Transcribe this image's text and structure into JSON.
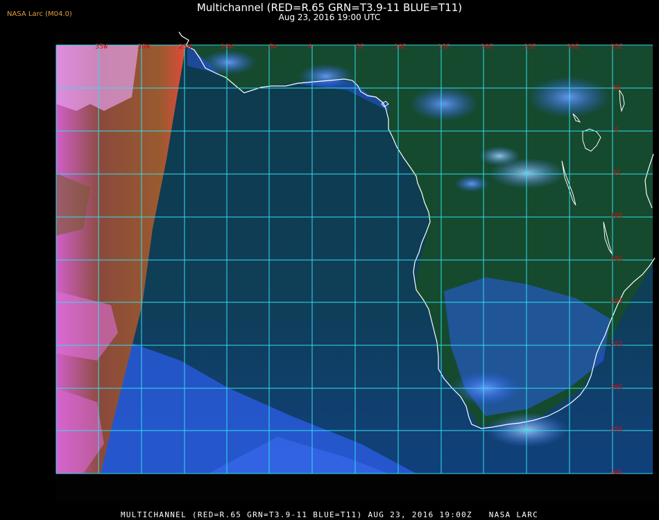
{
  "badge": "NASA Larc (M04.0)",
  "title": "Multichannel (RED=R.65 GRN=T3.9-11 BLUE=T11)",
  "subtitle": "Aug 23, 2016 19:00 UTC",
  "footer": "MULTICHANNEL (RED=R.65 GRN=T3.9-11 BLUE=T11) AUG 23, 2016 19:00Z   NASA LARC",
  "grid": {
    "lon_labels": [
      "35W",
      "30W",
      "25W",
      "10W",
      "5W",
      "0",
      "5E",
      "10E",
      "15E",
      "20E",
      "25E",
      "30E",
      "35E"
    ],
    "lat_labels": [
      "5N",
      "0",
      "5S",
      "10S",
      "15S",
      "20S",
      "25S",
      "30S",
      "35S",
      "40S"
    ],
    "line_color": "#30e0f0",
    "label_color": "#cc1010"
  },
  "colors": {
    "ocean": "#0f3a52",
    "land": "#15482a",
    "cloud_blue": "#3a78ff",
    "cloud_pink": "#e060d0",
    "coast": "#ffffff"
  }
}
